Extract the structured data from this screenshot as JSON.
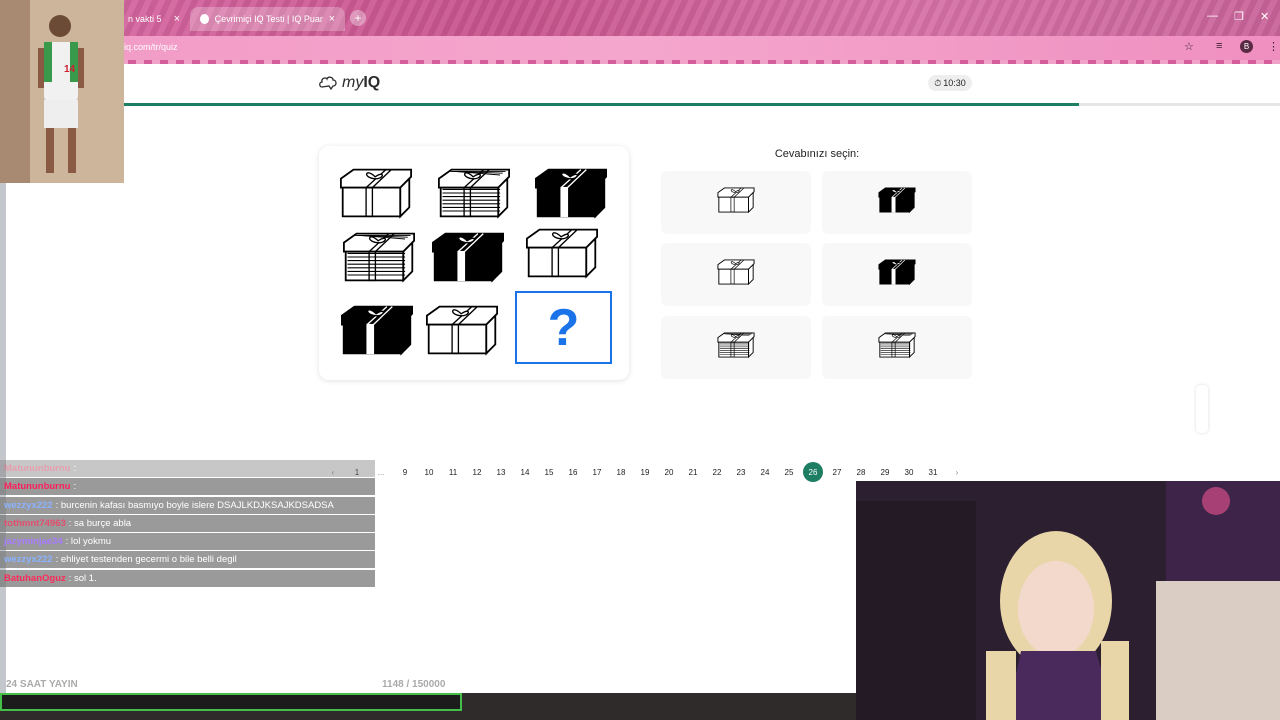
{
  "browser": {
    "tabs": [
      {
        "label": "n vakti 5",
        "active": false
      },
      {
        "label": "Çevrimiçi IQ Testi | IQ Puanınız",
        "active": true
      }
    ],
    "url": "iq.com/tr/quiz",
    "profile_initial": "B"
  },
  "header": {
    "logo_prefix": "my",
    "logo_suffix": "IQ",
    "timer": "10:30"
  },
  "quiz": {
    "progress_fraction": 0.826,
    "puzzle_cells": [
      {
        "style": "outline"
      },
      {
        "style": "striped"
      },
      {
        "style": "solid"
      },
      {
        "style": "striped"
      },
      {
        "style": "solid"
      },
      {
        "style": "outline"
      },
      {
        "style": "solid"
      },
      {
        "style": "outline"
      },
      {
        "style": "question"
      }
    ],
    "question_mark": "?",
    "answer_title": "Cevabınızı seçin:",
    "options": [
      {
        "style": "outline"
      },
      {
        "style": "solid"
      },
      {
        "style": "outline"
      },
      {
        "style": "solid"
      },
      {
        "style": "striped"
      },
      {
        "style": "striped"
      }
    ]
  },
  "pagination": {
    "prev": "‹",
    "next": "›",
    "ellipsis": "...",
    "pages": [
      "1",
      "9",
      "10",
      "11",
      "12",
      "13",
      "14",
      "15",
      "16",
      "17",
      "18",
      "19",
      "20",
      "21",
      "22",
      "23",
      "24",
      "25",
      "26",
      "27",
      "28",
      "29",
      "30",
      "31"
    ],
    "current": "26"
  },
  "chat": {
    "messages": [
      {
        "user": "Matununburnu",
        "text": ":",
        "color": "#d0516e",
        "faded": true
      },
      {
        "user": "Matununburnu",
        "text": ":",
        "color": "#ff1e5a",
        "faded": false
      },
      {
        "user": "wezzyx222",
        "text": ": burcenin kafası basmıyo boyle islere DSAJLKDJKSAJKDSADSA",
        "color": "#8ab2ff",
        "faded": false
      },
      {
        "user": "tothmnt74963",
        "text": ": sa burçe abla",
        "color": "#e34e6e",
        "faded": false
      },
      {
        "user": "jazyminjae34",
        "text": ": lol yokmu",
        "color": "#a67bff",
        "faded": false
      },
      {
        "user": "wezzyx222",
        "text": ": ehliyet testenden gecermi o bile belli degil",
        "color": "#8ab2ff",
        "faded": false
      },
      {
        "user": "BatuhanOguz",
        "text": ": sol 1.",
        "color": "#ff2a5a",
        "faded": false
      }
    ]
  },
  "overlay": {
    "stream_label": "24 SAAT YAYIN",
    "counter": "1148",
    "counter_total": "/ 150000"
  },
  "colors": {
    "accent_green": "#1e7e63",
    "question_blue": "#1a73e8"
  }
}
